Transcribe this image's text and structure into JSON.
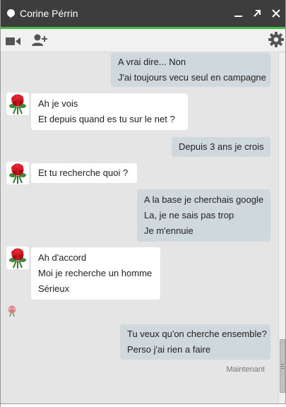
{
  "window": {
    "title": "Corine Pérrin",
    "accent_color": "#3dbd3d",
    "titlebar_color": "#3d3d3d"
  },
  "titlebar_buttons": {
    "minimize_icon": "minimize-icon",
    "popout_icon": "popout-arrow-icon",
    "close_icon": "close-icon"
  },
  "toolbar": {
    "video_icon": "video-camera-icon",
    "add_person_icon": "add-person-icon",
    "settings_icon": "gear-icon"
  },
  "messages": [
    {
      "direction": "out",
      "lines": [
        "A vrai dire... Non",
        "J'ai toujours vecu seul en campagne"
      ]
    },
    {
      "direction": "in",
      "lines": [
        "Ah je vois",
        "Et depuis quand es tu sur  le net ?"
      ]
    },
    {
      "direction": "out",
      "lines": [
        "Depuis 3 ans je crois"
      ]
    },
    {
      "direction": "in",
      "lines": [
        "Et tu recherche quoi ?"
      ]
    },
    {
      "direction": "out",
      "lines": [
        "A la base je cherchais google",
        "La, je ne sais pas trop",
        "Je m'ennuie"
      ]
    },
    {
      "direction": "in",
      "lines": [
        "Ah d'accord",
        "Moi je recherche un homme",
        "Sérieux"
      ]
    },
    {
      "direction": "out",
      "lines": [
        "Tu veux qu'on cherche ensemble?",
        "Perso j'ai rien a faire"
      ]
    }
  ],
  "timestamp": "Maintenant",
  "colors": {
    "outgoing_bubble": "#cfd8dc",
    "incoming_bubble": "#ffffff",
    "chat_background": "#e5e5e5"
  }
}
